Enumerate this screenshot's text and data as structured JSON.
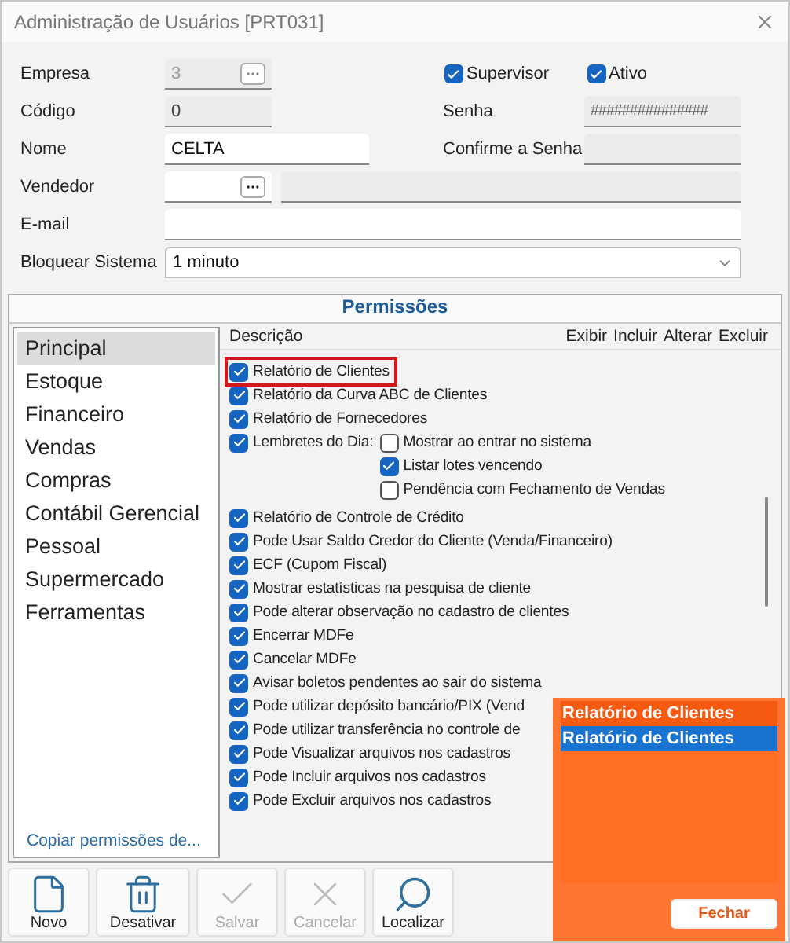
{
  "window": {
    "title": "Administração de Usuários [PRT031]"
  },
  "form": {
    "empresa": {
      "label": "Empresa",
      "value": "3",
      "disabled": true
    },
    "codigo": {
      "label": "Código",
      "value": "0"
    },
    "nome": {
      "label": "Nome",
      "value": "CELTA"
    },
    "vendedor": {
      "label": "Vendedor"
    },
    "email": {
      "label": "E-mail"
    },
    "bloquear": {
      "label": "Bloquear Sistema",
      "value": "1 minuto"
    },
    "supervisor": {
      "label": "Supervisor",
      "checked": true
    },
    "ativo": {
      "label": "Ativo",
      "checked": true
    },
    "senha": {
      "label": "Senha",
      "value": "###############"
    },
    "confirme": {
      "label": "Confirme a Senha"
    }
  },
  "permissions": {
    "title": "Permissões",
    "categories": [
      {
        "label": "Principal",
        "selected": true
      },
      {
        "label": "Estoque",
        "selected": false
      },
      {
        "label": "Financeiro",
        "selected": false
      },
      {
        "label": "Vendas",
        "selected": false
      },
      {
        "label": "Compras",
        "selected": false
      },
      {
        "label": "Contábil Gerencial",
        "selected": false
      },
      {
        "label": "Pessoal",
        "selected": false
      },
      {
        "label": "Supermercado",
        "selected": false
      },
      {
        "label": "Ferramentas",
        "selected": false
      }
    ],
    "copy_link": "Copiar permissões de...",
    "columns": [
      "Descrição",
      "Exibir",
      "Incluir",
      "Alterar",
      "Excluir"
    ],
    "items": [
      {
        "label": "Relatório de Clientes",
        "checked": true,
        "highlighted": true
      },
      {
        "label": "Relatório da Curva ABC de Clientes",
        "checked": true,
        "highlighted": false
      },
      {
        "label": "Relatório de Fornecedores",
        "checked": true,
        "highlighted": false
      },
      {
        "label": "Lembretes do Dia:",
        "checked": true,
        "highlighted": false,
        "children": [
          {
            "label": "Mostrar ao entrar no sistema",
            "checked": false
          },
          {
            "label": "Listar lotes vencendo",
            "checked": true
          },
          {
            "label": "Pendência com Fechamento de Vendas",
            "checked": false
          }
        ]
      },
      {
        "label": "Relatório de Controle de Crédito",
        "checked": true,
        "highlighted": false
      },
      {
        "label": "Pode Usar Saldo Credor do Cliente (Venda/Financeiro)",
        "checked": true,
        "highlighted": false
      },
      {
        "label": "ECF (Cupom Fiscal)",
        "checked": true,
        "highlighted": false
      },
      {
        "label": "Mostrar estatísticas na pesquisa de cliente",
        "checked": true,
        "highlighted": false
      },
      {
        "label": "Pode alterar observação no cadastro de clientes",
        "checked": true,
        "highlighted": false
      },
      {
        "label": "Encerrar MDFe",
        "checked": true,
        "highlighted": false
      },
      {
        "label": "Cancelar MDFe",
        "checked": true,
        "highlighted": false
      },
      {
        "label": "Avisar boletos pendentes ao sair do sistema",
        "checked": true,
        "highlighted": false
      },
      {
        "label": "Pode utilizar depósito bancário/PIX (Vend",
        "checked": true,
        "highlighted": false
      },
      {
        "label": "Pode utilizar transferência no controle de",
        "checked": true,
        "highlighted": false
      },
      {
        "label": "Pode Visualizar arquivos nos cadastros",
        "checked": true,
        "highlighted": false
      },
      {
        "label": "Pode Incluir arquivos nos cadastros",
        "checked": true,
        "highlighted": false
      },
      {
        "label": "Pode Excluir arquivos nos cadastros",
        "checked": true,
        "highlighted": false
      }
    ]
  },
  "toolbar": [
    {
      "label": "Novo",
      "kind": "new",
      "disabled": false
    },
    {
      "label": "Desativar",
      "kind": "delete",
      "disabled": false
    },
    {
      "label": "Salvar",
      "kind": "save",
      "disabled": true
    },
    {
      "label": "Cancelar",
      "kind": "cancel",
      "disabled": true
    },
    {
      "label": "Localizar",
      "kind": "find",
      "disabled": false
    }
  ],
  "popup": {
    "items": [
      {
        "label": "Relatório de Clientes",
        "selected": false
      },
      {
        "label": "Relatório de Clientes",
        "selected": true
      }
    ],
    "close_button": "Fechar"
  }
}
